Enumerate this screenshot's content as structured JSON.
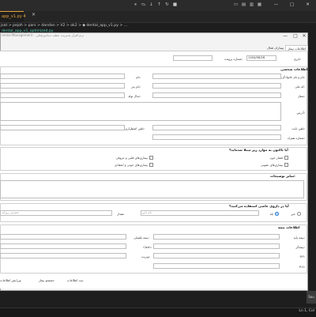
{
  "editor": {
    "active_tab": "app_v1.py 4",
    "breadcrumb": "jsat > pejoh > pars > dandan > V2 > ok2 > ◆ dental_app_v1.py > ...",
    "code_line": "dental_app_v1_optimized.py",
    "status_text": "Ln 1, Col"
  },
  "window": {
    "title": "rental Management - نرم افزار مدیریت مطب دندانپزشکی",
    "controls": [
      "—",
      "□",
      "✕"
    ]
  },
  "tabs": [
    {
      "label": "اطلاعات بیمار"
    },
    {
      "label": "بیماران فعال"
    }
  ],
  "header_fields": {
    "date_label": "تاریخ:",
    "date_value": "1404/08/26",
    "file_no_label": "شماره پرونده:"
  },
  "personal": {
    "title": "اطلاعات شخصی:",
    "first_name_label": "نام:",
    "first_name_right_label": "نام و نام خانوادگی:",
    "father_label": "نام پدر:",
    "national_id_label": "کد ملی:",
    "gender_label": "جنسیت:",
    "birth_label": "سال تولد:",
    "job_label": "شغل:",
    "address_label": "آدرس:",
    "phone_label": "تلفن ثابت:",
    "emergency_label": "تلفن اضطراری:",
    "mobile_label": "شماره همراه:"
  },
  "conditions": {
    "title": "آیا تاکنون به موارد زیر مبتلا شده‌اید؟",
    "items_right": [
      "فشار خون",
      "بیماری‌های عفونی"
    ],
    "items_left": [
      "بیماری‌های قلبی و عروقی",
      "بیماری‌های خونی و انعقادی"
    ]
  },
  "other_notes": {
    "title": "سایر توضیحات:"
  },
  "medication": {
    "title": "آیا در داروی خاصی استفاده می‌کنید؟",
    "yes_label": "بله",
    "no_label": "خیر",
    "drug_placeholder": "نام دارو",
    "dose_label": "مقدار",
    "dose_placeholder": "مصرف روزانه"
  },
  "insurance": {
    "title": "اطلاعات بیمه",
    "primary_label": "بیمه پایه:",
    "supplementary_label": "بیمه تکمیلی:",
    "insurer_label": "بیمه‌گر:",
    "cash_label": "Cash:",
    "visit_label": "ویزیت:",
    "misc_label": "بیمه:",
    "ph1_label": "P.P:",
    "ph2_label": "P.O:"
  },
  "buttons": {
    "save": "ثبت اطلاعات",
    "new": "جستجو بیمار",
    "clear": "ویرایش اطلاعات"
  },
  "side_button": "Sou"
}
